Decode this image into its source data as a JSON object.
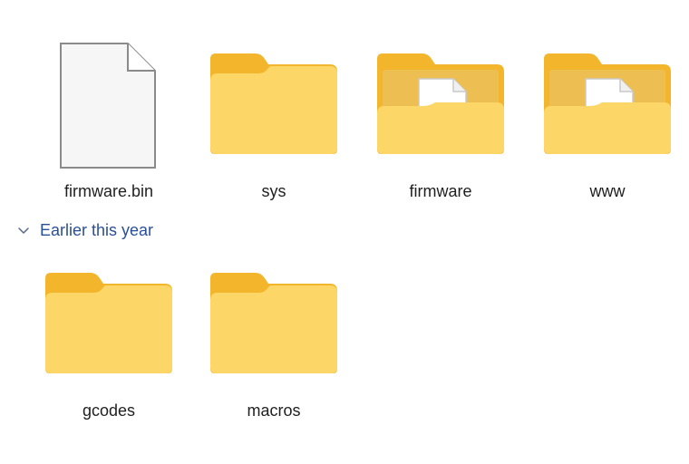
{
  "explorer": {
    "top_items": [
      {
        "name": "firmware.bin",
        "type": "file"
      },
      {
        "name": "sys",
        "type": "folder"
      },
      {
        "name": "firmware",
        "type": "folder-with-file"
      },
      {
        "name": "www",
        "type": "folder-with-file"
      }
    ],
    "group_header": {
      "label": "Earlier this year",
      "icon": "chevron-down-icon"
    },
    "group_items": [
      {
        "name": "gcodes",
        "type": "folder"
      },
      {
        "name": "macros",
        "type": "folder"
      }
    ]
  },
  "colors": {
    "folder_back": "#F3B52B",
    "folder_front": "#FCD768",
    "file_outline": "#8a8a8a",
    "header_text": "#2a4f9a"
  }
}
